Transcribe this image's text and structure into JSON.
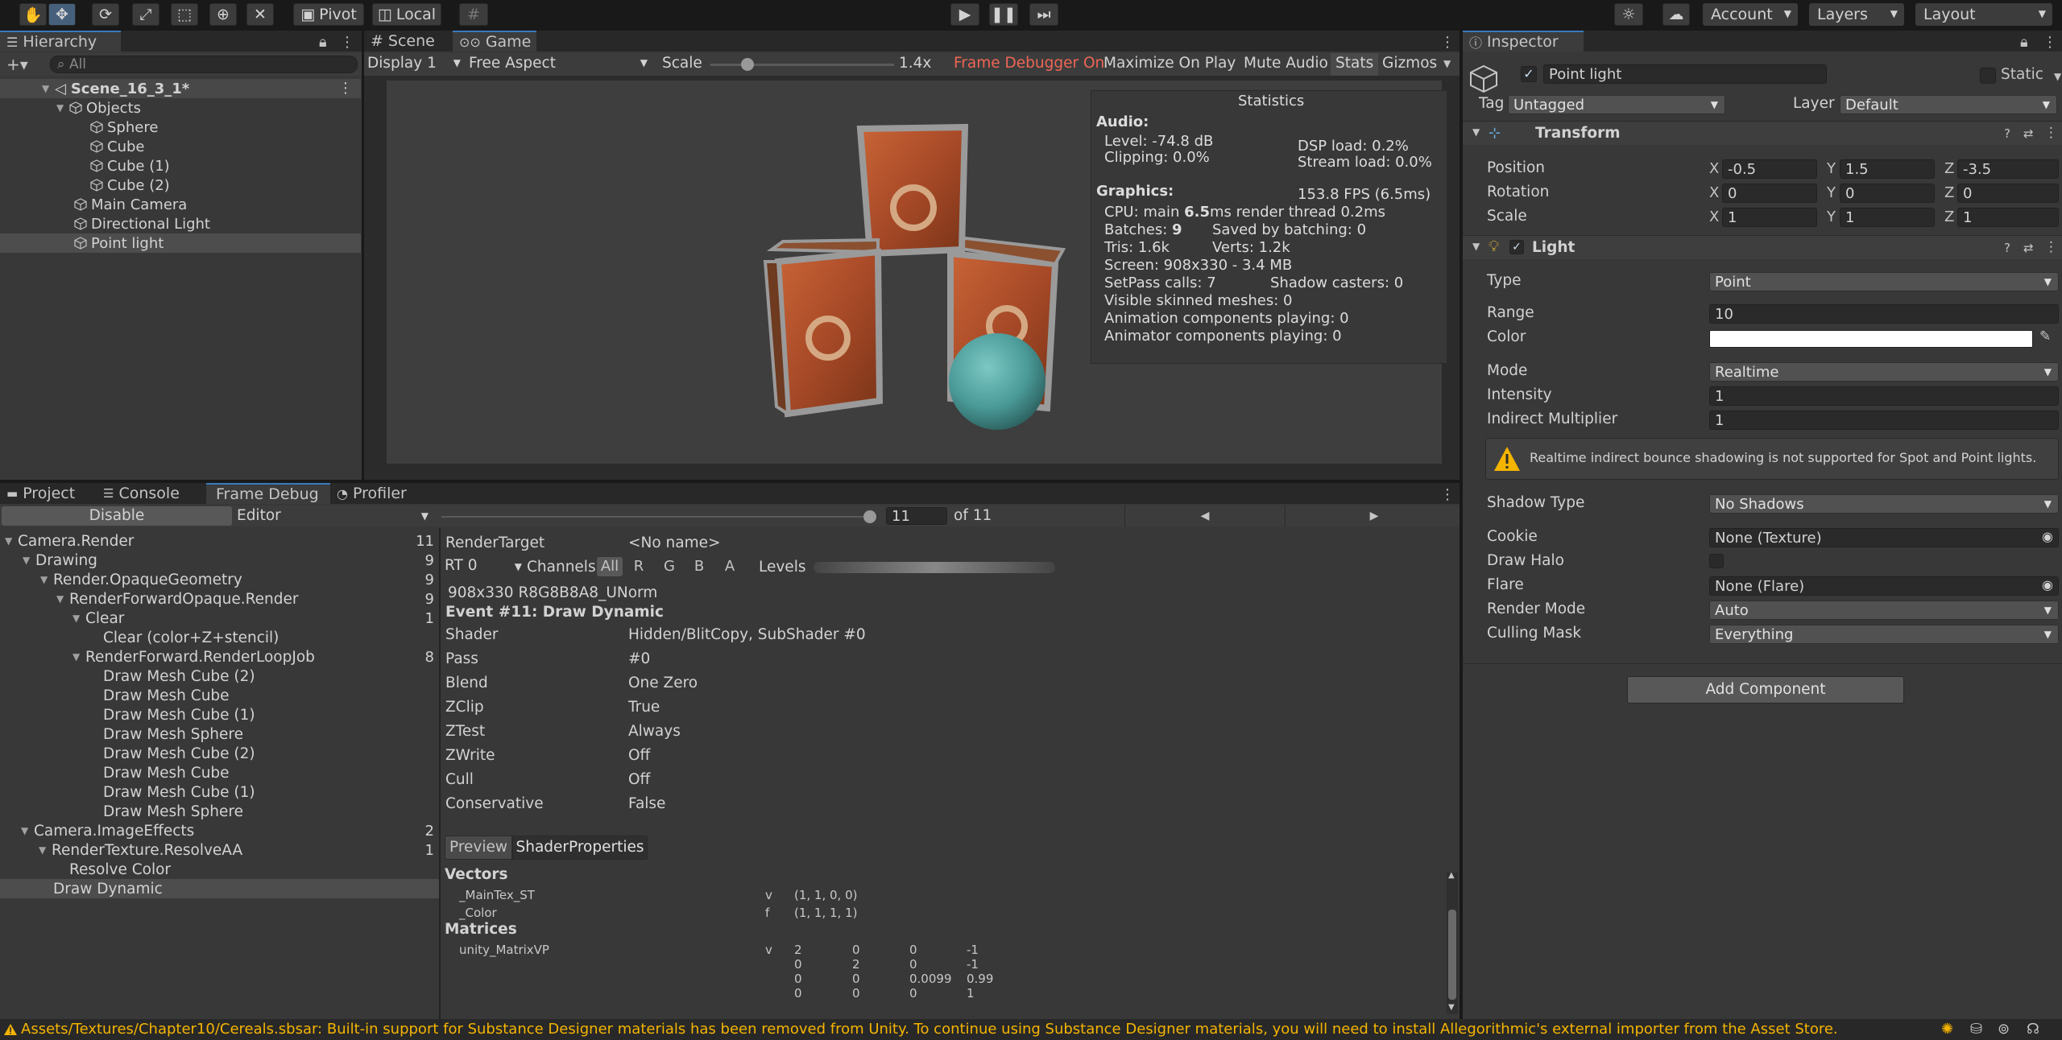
{
  "toolbar": {
    "pivot": "Pivot",
    "local": "Local",
    "account": "Account",
    "layers": "Layers",
    "layout": "Layout"
  },
  "hierarchy": {
    "tab": "Hierarchy",
    "search_placeholder": "All",
    "scene": "Scene_16_3_1*",
    "items": [
      {
        "label": "Objects"
      },
      {
        "label": "Sphere"
      },
      {
        "label": "Cube"
      },
      {
        "label": "Cube (1)"
      },
      {
        "label": "Cube (2)"
      },
      {
        "label": "Main Camera"
      },
      {
        "label": "Directional Light"
      },
      {
        "label": "Point light"
      }
    ]
  },
  "game": {
    "tabs": [
      "Scene",
      "Game"
    ],
    "display": "Display 1",
    "aspect": "Free Aspect",
    "scale_label": "Scale",
    "scale_value": "1.4x",
    "scale_fraction": 0.2,
    "frame_debugger_on": "Frame Debugger On",
    "maximize": "Maximize On Play",
    "mute": "Mute Audio",
    "stats": "Stats",
    "gizmos": "Gizmos"
  },
  "statistics": {
    "title": "Statistics",
    "audio_header": "Audio:",
    "level": "Level: -74.8 dB",
    "clipping": "Clipping: 0.0%",
    "dsp": "DSP load: 0.2%",
    "stream": "Stream load: 0.0%",
    "graphics_header": "Graphics:",
    "fps": "153.8 FPS (6.5ms)",
    "cpu_prefix": "CPU: main ",
    "cpu_main": "6.5",
    "cpu_suffix": "ms  render thread 0.2ms",
    "batches_prefix": "Batches: ",
    "batches": "9",
    "saved": "Saved by batching: 0",
    "tris": "Tris: 1.6k",
    "verts": "Verts: 1.2k",
    "screen": "Screen: 908x330 - 3.4 MB",
    "setpass": "SetPass calls: 7",
    "shadow_casters": "Shadow casters: 0",
    "skinned": "Visible skinned meshes: 0",
    "animation": "Animation components playing: 0",
    "animator": "Animator components playing: 0"
  },
  "bottom_tabs": [
    "Project",
    "Console",
    "Frame Debug",
    "Profiler"
  ],
  "frame_debug": {
    "disable": "Disable",
    "editor": "Editor",
    "event_index": "11",
    "event_fraction": 1.0,
    "of_total": "of 11",
    "tree": [
      {
        "label": "Camera.Render",
        "count": "11"
      },
      {
        "label": "Drawing",
        "count": "9"
      },
      {
        "label": "Render.OpaqueGeometry",
        "count": "9"
      },
      {
        "label": "RenderForwardOpaque.Render",
        "count": "9"
      },
      {
        "label": "Clear",
        "count": "1"
      },
      {
        "label": "Clear (color+Z+stencil)",
        "count": ""
      },
      {
        "label": "RenderForward.RenderLoopJob",
        "count": "8"
      },
      {
        "label": "Draw Mesh Cube (2)",
        "count": ""
      },
      {
        "label": "Draw Mesh Cube",
        "count": ""
      },
      {
        "label": "Draw Mesh Cube (1)",
        "count": ""
      },
      {
        "label": "Draw Mesh Sphere",
        "count": ""
      },
      {
        "label": "Draw Mesh Cube (2)",
        "count": ""
      },
      {
        "label": "Draw Mesh Cube",
        "count": ""
      },
      {
        "label": "Draw Mesh Cube (1)",
        "count": ""
      },
      {
        "label": "Draw Mesh Sphere",
        "count": ""
      },
      {
        "label": "Camera.ImageEffects",
        "count": "2"
      },
      {
        "label": "RenderTexture.ResolveAA",
        "count": "1"
      },
      {
        "label": "Resolve Color",
        "count": ""
      },
      {
        "label": "Draw Dynamic",
        "count": ""
      }
    ],
    "render_target_label": "RenderTarget",
    "render_target_value": "<No name>",
    "rt": "RT 0",
    "channels_label": "Channels",
    "channels": [
      "All",
      "R",
      "G",
      "B",
      "A"
    ],
    "levels_label": "Levels",
    "format": "908x330 R8G8B8A8_UNorm",
    "event_title": "Event #11: Draw Dynamic",
    "props": [
      {
        "k": "Shader",
        "v": "Hidden/BlitCopy, SubShader #0"
      },
      {
        "k": "Pass",
        "v": "#0"
      },
      {
        "k": "Blend",
        "v": "One Zero"
      },
      {
        "k": "ZClip",
        "v": "True"
      },
      {
        "k": "ZTest",
        "v": "Always"
      },
      {
        "k": "ZWrite",
        "v": "Off"
      },
      {
        "k": "Cull",
        "v": "Off"
      },
      {
        "k": "Conservative",
        "v": "False"
      }
    ],
    "preview_tab": "Preview",
    "shaderprops_tab": "ShaderProperties",
    "vectors_header": "Vectors",
    "maintex_name": "_MainTex_ST",
    "maintex_type": "v",
    "maintex_value": "(1, 1, 0, 0)",
    "color_name": "_Color",
    "color_type": "f",
    "color_value": "(1, 1, 1, 1)",
    "matrices_header": "Matrices",
    "matrix_name": "unity_MatrixVP",
    "matrix_type": "v",
    "matrix": [
      [
        "2",
        "0",
        "0",
        "-1"
      ],
      [
        "0",
        "2",
        "0",
        "-1"
      ],
      [
        "0",
        "0",
        "0.0099",
        "0.99"
      ],
      [
        "0",
        "0",
        "0",
        "1"
      ]
    ]
  },
  "inspector": {
    "tab": "Inspector",
    "object_name": "Point light",
    "static_label": "Static",
    "tag_label": "Tag",
    "tag_value": "Untagged",
    "layer_label": "Layer",
    "layer_value": "Default",
    "transform_title": "Transform",
    "position_label": "Position",
    "rotation_label": "Rotation",
    "scale_label": "Scale",
    "axis_x": "X",
    "axis_y": "Y",
    "axis_z": "Z",
    "position": [
      "-0.5",
      "1.5",
      "-3.5"
    ],
    "rotation": [
      "0",
      "0",
      "0"
    ],
    "scale": [
      "1",
      "1",
      "1"
    ],
    "light_title": "Light",
    "type_label": "Type",
    "type_value": "Point",
    "range_label": "Range",
    "range_value": "10",
    "color_label": "Color",
    "color_value": "#ffffff",
    "mode_label": "Mode",
    "mode_value": "Realtime",
    "intensity_label": "Intensity",
    "intensity_value": "1",
    "indirect_label": "Indirect Multiplier",
    "indirect_value": "1",
    "warning": "Realtime indirect bounce shadowing is not supported for Spot and Point lights.",
    "shadow_type_label": "Shadow Type",
    "shadow_type_value": "No Shadows",
    "cookie_label": "Cookie",
    "cookie_value": "None (Texture)",
    "draw_halo_label": "Draw Halo",
    "flare_label": "Flare",
    "flare_value": "None (Flare)",
    "render_mode_label": "Render Mode",
    "render_mode_value": "Auto",
    "culling_label": "Culling Mask",
    "culling_value": "Everything",
    "add_component": "Add Component"
  },
  "status_bar": {
    "message": "Assets/Textures/Chapter10/Cereals.sbsar: Built-in support for Substance Designer materials has been removed from Unity. To continue using Substance Designer materials, you will need to install Allegorithmic's external importer from the Asset Store."
  },
  "colors": {
    "accent": "#3a79bb",
    "frame_debugger_text": "#ee6655",
    "warning": "#f4b400",
    "cube_rust": "#b5532e",
    "sphere": "#4a9a98"
  }
}
